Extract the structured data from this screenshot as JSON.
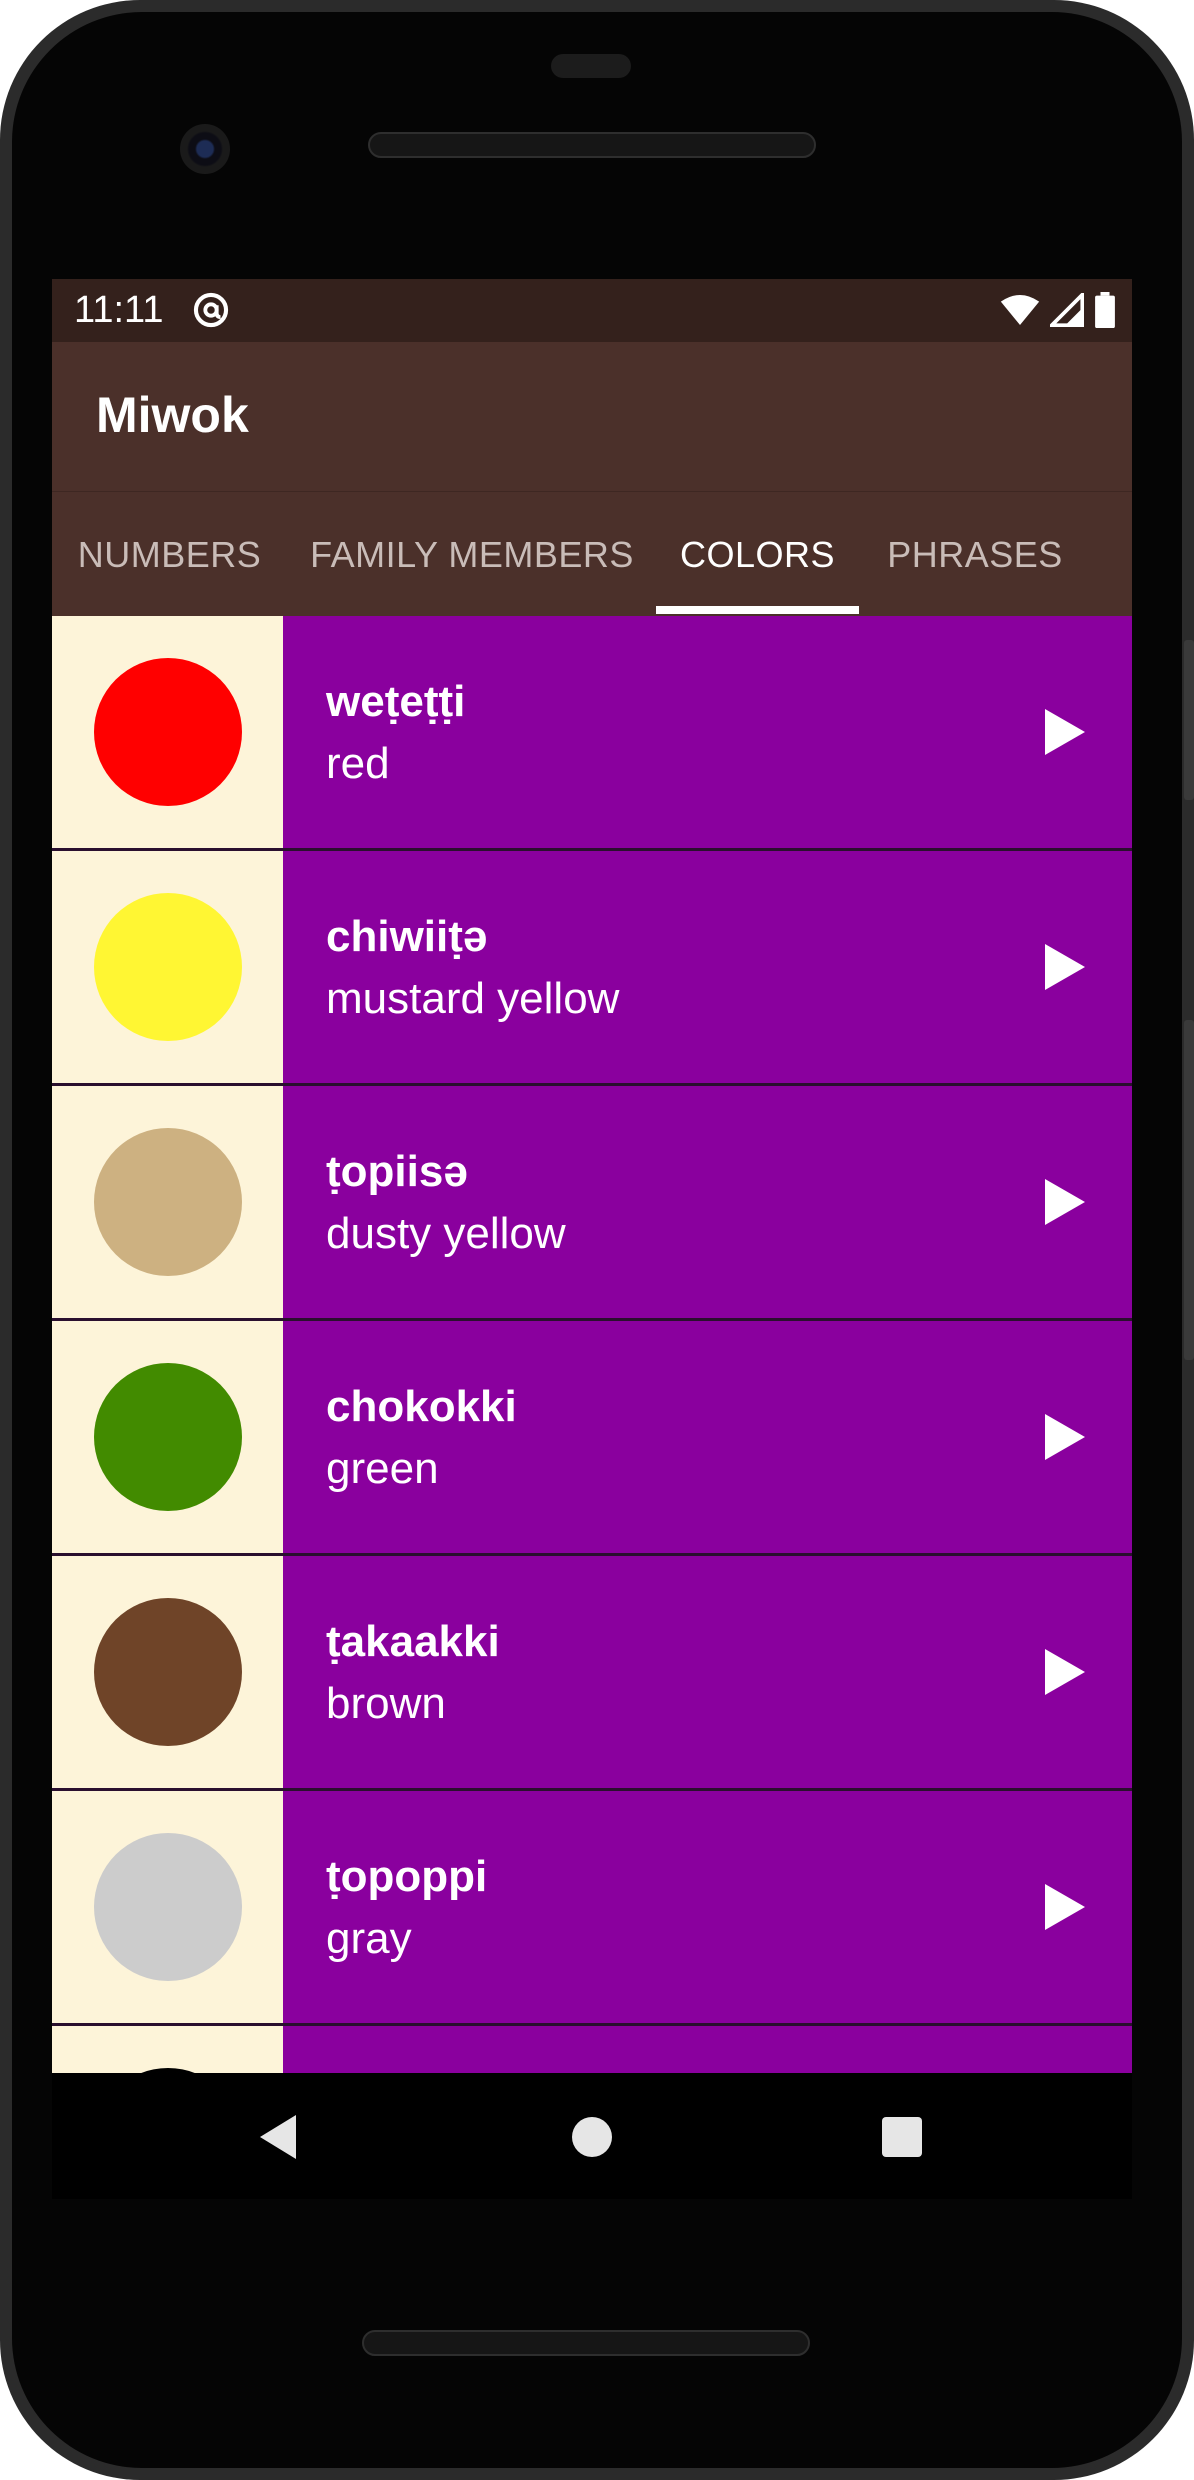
{
  "status_bar": {
    "time": "11:11",
    "icons": [
      "at-sign-icon",
      "wifi-icon",
      "signal-icon",
      "battery-icon"
    ]
  },
  "app_bar": {
    "title": "Miwok"
  },
  "tabs": [
    {
      "label": "NUMBERS",
      "active": false
    },
    {
      "label": "FAMILY MEMBERS",
      "active": false
    },
    {
      "label": "COLORS",
      "active": true
    },
    {
      "label": "PHRASES",
      "active": false
    }
  ],
  "colors_list": [
    {
      "miwok": "weṭeṭṭi",
      "english": "red",
      "swatch": "#ff0000"
    },
    {
      "miwok": "chiwiiṭə",
      "english": "mustard yellow",
      "swatch": "#fff633"
    },
    {
      "miwok": "ṭopiisə",
      "english": "dusty yellow",
      "swatch": "#cdb181"
    },
    {
      "miwok": "chokokki",
      "english": "green",
      "swatch": "#428b00"
    },
    {
      "miwok": "ṭakaakki",
      "english": "brown",
      "swatch": "#6f4428"
    },
    {
      "miwok": "ṭopoppi",
      "english": "gray",
      "swatch": "#cccccc"
    },
    {
      "miwok": "",
      "english": "",
      "swatch": "#000000"
    }
  ],
  "theme": {
    "status_bar": "#34211c",
    "app_bar": "#4b302a",
    "item_background": "#8a009e",
    "swatch_background": "#fdf4d9",
    "tab_inactive": "#c9bcb8",
    "tab_active": "#ffffff"
  },
  "nav_bar": {
    "buttons": [
      "back-icon",
      "home-icon",
      "recents-icon"
    ]
  }
}
